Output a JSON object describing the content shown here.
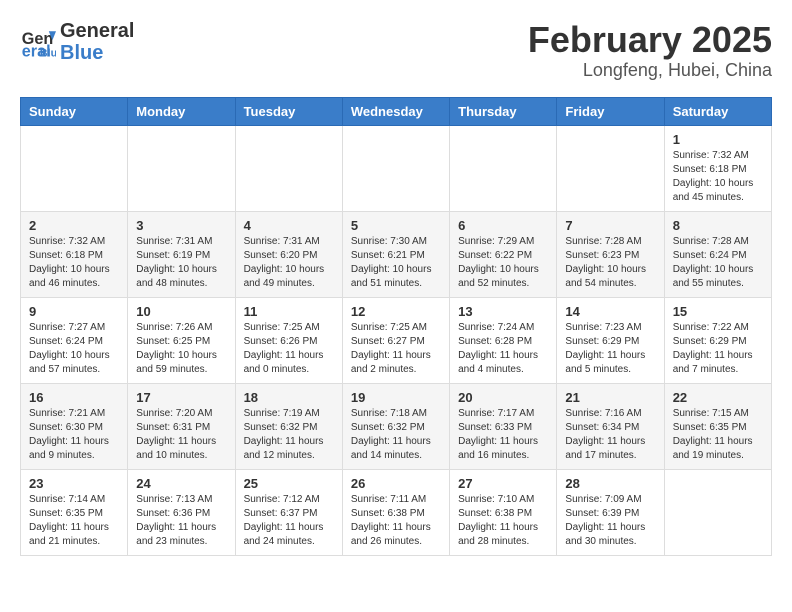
{
  "header": {
    "logo_line1": "General",
    "logo_line2": "Blue",
    "title": "February 2025",
    "subtitle": "Longfeng, Hubei, China"
  },
  "weekdays": [
    "Sunday",
    "Monday",
    "Tuesday",
    "Wednesday",
    "Thursday",
    "Friday",
    "Saturday"
  ],
  "weeks": [
    [
      {
        "day": "",
        "info": ""
      },
      {
        "day": "",
        "info": ""
      },
      {
        "day": "",
        "info": ""
      },
      {
        "day": "",
        "info": ""
      },
      {
        "day": "",
        "info": ""
      },
      {
        "day": "",
        "info": ""
      },
      {
        "day": "1",
        "info": "Sunrise: 7:32 AM\nSunset: 6:18 PM\nDaylight: 10 hours\nand 45 minutes."
      }
    ],
    [
      {
        "day": "2",
        "info": "Sunrise: 7:32 AM\nSunset: 6:18 PM\nDaylight: 10 hours\nand 46 minutes."
      },
      {
        "day": "3",
        "info": "Sunrise: 7:31 AM\nSunset: 6:19 PM\nDaylight: 10 hours\nand 48 minutes."
      },
      {
        "day": "4",
        "info": "Sunrise: 7:31 AM\nSunset: 6:20 PM\nDaylight: 10 hours\nand 49 minutes."
      },
      {
        "day": "5",
        "info": "Sunrise: 7:30 AM\nSunset: 6:21 PM\nDaylight: 10 hours\nand 51 minutes."
      },
      {
        "day": "6",
        "info": "Sunrise: 7:29 AM\nSunset: 6:22 PM\nDaylight: 10 hours\nand 52 minutes."
      },
      {
        "day": "7",
        "info": "Sunrise: 7:28 AM\nSunset: 6:23 PM\nDaylight: 10 hours\nand 54 minutes."
      },
      {
        "day": "8",
        "info": "Sunrise: 7:28 AM\nSunset: 6:24 PM\nDaylight: 10 hours\nand 55 minutes."
      }
    ],
    [
      {
        "day": "9",
        "info": "Sunrise: 7:27 AM\nSunset: 6:24 PM\nDaylight: 10 hours\nand 57 minutes."
      },
      {
        "day": "10",
        "info": "Sunrise: 7:26 AM\nSunset: 6:25 PM\nDaylight: 10 hours\nand 59 minutes."
      },
      {
        "day": "11",
        "info": "Sunrise: 7:25 AM\nSunset: 6:26 PM\nDaylight: 11 hours\nand 0 minutes."
      },
      {
        "day": "12",
        "info": "Sunrise: 7:25 AM\nSunset: 6:27 PM\nDaylight: 11 hours\nand 2 minutes."
      },
      {
        "day": "13",
        "info": "Sunrise: 7:24 AM\nSunset: 6:28 PM\nDaylight: 11 hours\nand 4 minutes."
      },
      {
        "day": "14",
        "info": "Sunrise: 7:23 AM\nSunset: 6:29 PM\nDaylight: 11 hours\nand 5 minutes."
      },
      {
        "day": "15",
        "info": "Sunrise: 7:22 AM\nSunset: 6:29 PM\nDaylight: 11 hours\nand 7 minutes."
      }
    ],
    [
      {
        "day": "16",
        "info": "Sunrise: 7:21 AM\nSunset: 6:30 PM\nDaylight: 11 hours\nand 9 minutes."
      },
      {
        "day": "17",
        "info": "Sunrise: 7:20 AM\nSunset: 6:31 PM\nDaylight: 11 hours\nand 10 minutes."
      },
      {
        "day": "18",
        "info": "Sunrise: 7:19 AM\nSunset: 6:32 PM\nDaylight: 11 hours\nand 12 minutes."
      },
      {
        "day": "19",
        "info": "Sunrise: 7:18 AM\nSunset: 6:32 PM\nDaylight: 11 hours\nand 14 minutes."
      },
      {
        "day": "20",
        "info": "Sunrise: 7:17 AM\nSunset: 6:33 PM\nDaylight: 11 hours\nand 16 minutes."
      },
      {
        "day": "21",
        "info": "Sunrise: 7:16 AM\nSunset: 6:34 PM\nDaylight: 11 hours\nand 17 minutes."
      },
      {
        "day": "22",
        "info": "Sunrise: 7:15 AM\nSunset: 6:35 PM\nDaylight: 11 hours\nand 19 minutes."
      }
    ],
    [
      {
        "day": "23",
        "info": "Sunrise: 7:14 AM\nSunset: 6:35 PM\nDaylight: 11 hours\nand 21 minutes."
      },
      {
        "day": "24",
        "info": "Sunrise: 7:13 AM\nSunset: 6:36 PM\nDaylight: 11 hours\nand 23 minutes."
      },
      {
        "day": "25",
        "info": "Sunrise: 7:12 AM\nSunset: 6:37 PM\nDaylight: 11 hours\nand 24 minutes."
      },
      {
        "day": "26",
        "info": "Sunrise: 7:11 AM\nSunset: 6:38 PM\nDaylight: 11 hours\nand 26 minutes."
      },
      {
        "day": "27",
        "info": "Sunrise: 7:10 AM\nSunset: 6:38 PM\nDaylight: 11 hours\nand 28 minutes."
      },
      {
        "day": "28",
        "info": "Sunrise: 7:09 AM\nSunset: 6:39 PM\nDaylight: 11 hours\nand 30 minutes."
      },
      {
        "day": "",
        "info": ""
      }
    ]
  ]
}
